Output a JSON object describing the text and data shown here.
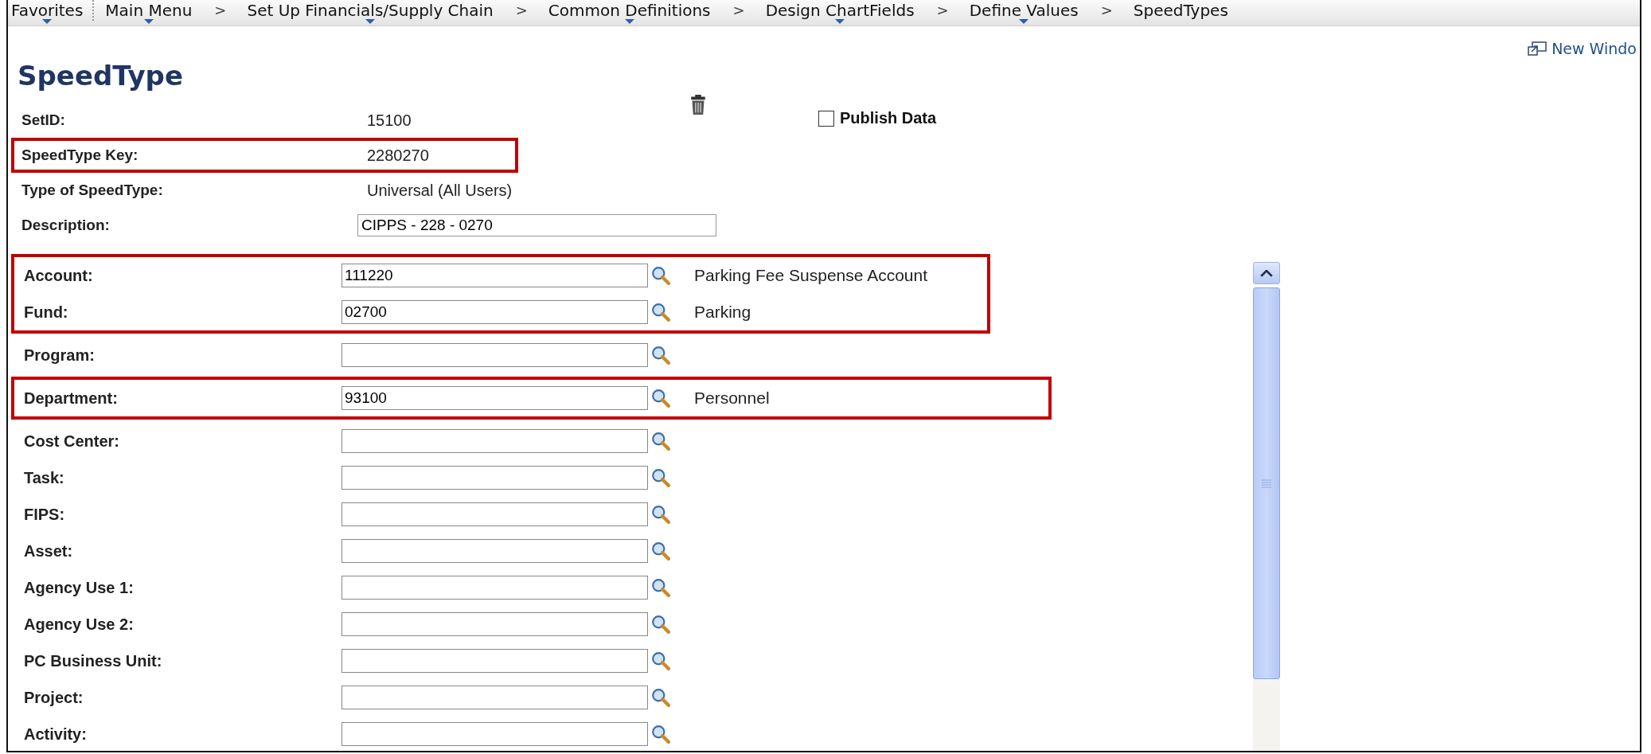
{
  "breadcrumb": {
    "separator": ">",
    "items": [
      {
        "label": "Favorites",
        "has_menu": true
      },
      {
        "label": "Main Menu",
        "has_menu": true
      },
      {
        "label": "Set Up Financials/Supply Chain",
        "has_menu": true
      },
      {
        "label": "Common Definitions",
        "has_menu": true
      },
      {
        "label": "Design ChartFields",
        "has_menu": true
      },
      {
        "label": "Define Values",
        "has_menu": true
      },
      {
        "label": "SpeedTypes",
        "has_menu": false
      }
    ]
  },
  "new_window_link": "New Windo",
  "title": "SpeedType",
  "publish_data": {
    "label": "Publish Data",
    "checked": false
  },
  "header_fields": [
    {
      "kind": "text",
      "label": "SetID:",
      "value": "15100",
      "highlighted": false
    },
    {
      "kind": "text",
      "label": "SpeedType Key:",
      "value": "2280270",
      "highlighted": true
    },
    {
      "kind": "text",
      "label": "Type of SpeedType:",
      "value": "Universal (All Users)",
      "highlighted": false
    },
    {
      "kind": "input",
      "label": "Description:",
      "value": "CIPPS - 228 - 0270",
      "highlighted": false
    }
  ],
  "chartfield_groups": [
    {
      "highlighted": true,
      "fields": [
        {
          "label": "Account:",
          "value": "111220",
          "description": "Parking Fee Suspense Account"
        },
        {
          "label": "Fund:",
          "value": "02700",
          "description": "Parking"
        }
      ]
    },
    {
      "highlighted": false,
      "fields": [
        {
          "label": "Program:"
        }
      ]
    },
    {
      "highlighted": true,
      "fields": [
        {
          "label": "Department:",
          "value": "93100",
          "description": "Personnel"
        }
      ]
    },
    {
      "highlighted": false,
      "fields": [
        {
          "label": "Cost Center:"
        },
        {
          "label": "Task:"
        },
        {
          "label": "FIPS:"
        },
        {
          "label": "Asset:"
        },
        {
          "label": "Agency Use 1:"
        },
        {
          "label": "Agency Use 2:"
        },
        {
          "label": "PC Business Unit:"
        },
        {
          "label": "Project:"
        },
        {
          "label": "Activity:"
        }
      ]
    }
  ]
}
